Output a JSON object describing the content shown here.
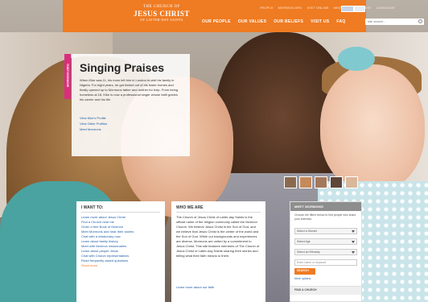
{
  "header": {
    "logo": {
      "line1": "THE CHURCH OF",
      "line2": "JESUS CHRIST",
      "line3": "OF LATTER-DAY SAINTS"
    },
    "utility_links": [
      "PEOPLE",
      "MORMON.ORG",
      "VISIT ONLINE",
      "MISSIONARY REQUEST",
      "LANGUAGE"
    ],
    "nav": [
      "OUR PEOPLE",
      "OUR VALUES",
      "OUR BELIEFS",
      "VISIT US",
      "FAQ"
    ],
    "search": {
      "placeholder": "site search..."
    }
  },
  "feature": {
    "tab_label": "MORMON.ORG",
    "title": "Singing Praises",
    "body": "When Kike was 11, his mom left him in London to visit his family in Nigeria. For eight years, he got kicked out of his foster homes and finally opened up to Mormons father and mother for help. From being homeless at 18, Kike is now a professional singer whose faith guides his career and his life.",
    "links": [
      "View Kike's Profile",
      "View Other Profiles",
      "Meet Mormons"
    ]
  },
  "thumbnail_count": 5,
  "i_want_to": {
    "heading": "I WANT TO:",
    "items": [
      "Learn more about Jesus Christ",
      "Find a Church near me",
      "Order a free Book of Mormon",
      "Meet Mormons and hear their stories",
      "Chat with a missionary now",
      "Learn about family history",
      "Meet with Mormon missionaries",
      "Learn about people Jesus",
      "Chat with Church representatives",
      "Read frequently asked questions",
      "Show more"
    ]
  },
  "who_we_are": {
    "heading": "WHO WE ARE",
    "body": "The Church of Jesus Christ of Latter-day Saints is the official name of the religion commonly called the Mormon Church. We believe Jesus Christ is the Son of God, and we believe that Jesus Christ is the center of the world and the Son of God. While our backgrounds and experiences are diverse, Mormons are united by a commitment to Jesus Christ. This site features members of The Church of Jesus Christ of Latter-day Saints sharing their stories and telling what their faith means to them.",
    "more_link": "Learn more about our faith"
  },
  "meet_mormons": {
    "heading": "MEET MORMONS",
    "description": "Choose the filters below to find people who share your interests.",
    "selects": [
      "Select a Gender",
      "Select Age",
      "Select an Ethnicity"
    ],
    "zip_placeholder": "Enter name or keyword",
    "search_button": "SEARCH",
    "more_link": "More options",
    "find_church": "FIND A CHURCH"
  },
  "colors": {
    "brand_orange": "#ef7b22",
    "tab_pink": "#d92e7f",
    "link_blue": "#1f5ea8"
  }
}
